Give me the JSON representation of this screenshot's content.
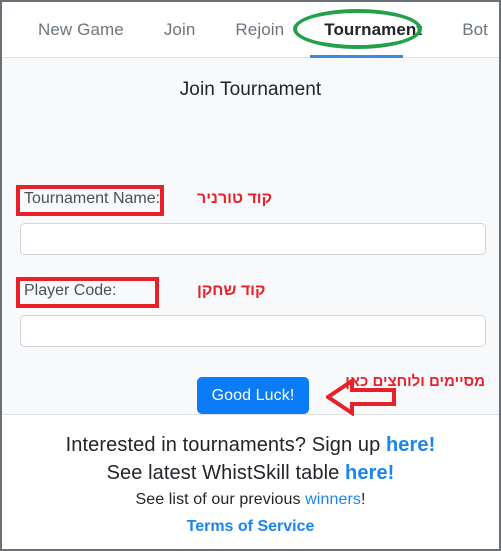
{
  "window": {
    "frame_color": "#6b6f76"
  },
  "tabs": {
    "items": [
      {
        "label": "New Game",
        "active": false
      },
      {
        "label": "Join",
        "active": false
      },
      {
        "label": "Rejoin",
        "active": false
      },
      {
        "label": "Tournament",
        "active": true
      },
      {
        "label": "Bot",
        "active": false
      }
    ],
    "active_underline_color": "#3b8ae2",
    "annotation_ellipse_color": "#22a04a"
  },
  "form": {
    "heading": "Join Tournament",
    "tournament_name": {
      "label": "Tournament Name:",
      "value": "",
      "placeholder": "",
      "hebrew_note": "קוד טורניר"
    },
    "player_code": {
      "label": "Player Code:",
      "value": "",
      "placeholder": "",
      "hebrew_note": "קוד שחקן"
    },
    "submit_label": "Good Luck!",
    "submit_color": "#0b7bf7",
    "hebrew_click_note": "מסיימים ולוחצים כאן",
    "annotation_color": "#e8202a"
  },
  "footer": {
    "line1_text": "Interested in tournaments? Sign up ",
    "line1_link": "here!",
    "line2_text": "See latest WhistSkill table ",
    "line2_link": "here!",
    "line3_prefix": "See list of our previous ",
    "line3_link": "winners",
    "line3_suffix": "!",
    "tos_link": "Terms of Service",
    "link_color": "#1a84ef"
  }
}
